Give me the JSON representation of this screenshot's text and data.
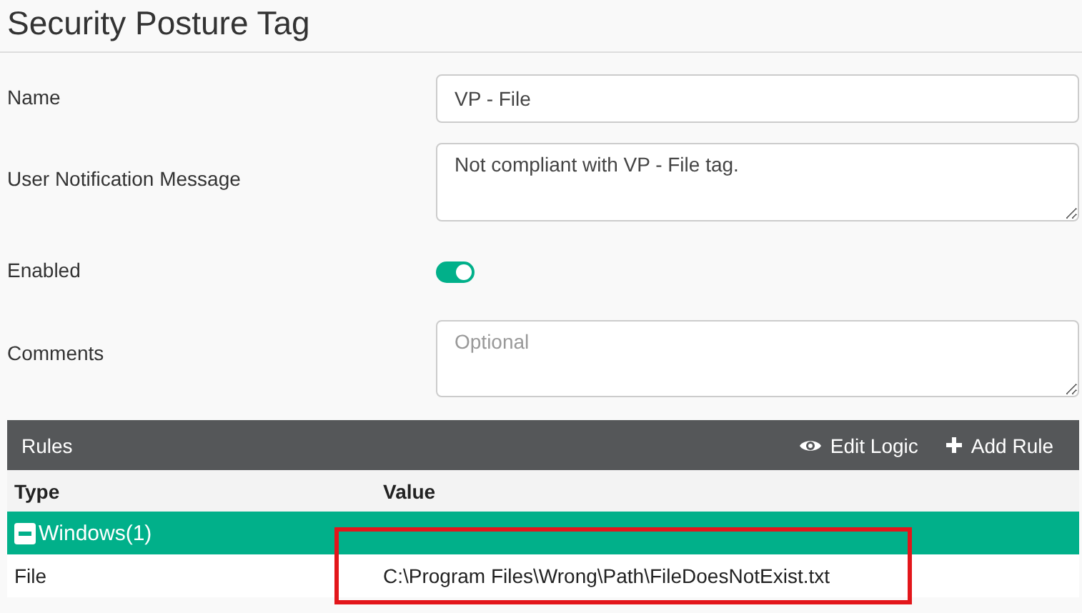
{
  "title": "Security Posture Tag",
  "fields": [
    {
      "kind": "text",
      "label": "Name",
      "value": "VP - File"
    },
    {
      "kind": "textarea",
      "label": "User Notification Message",
      "value": "Not compliant with VP - File tag."
    },
    {
      "kind": "toggle",
      "label": "Enabled",
      "on": true
    },
    {
      "kind": "textarea",
      "label": "Comments",
      "placeholder": "Optional"
    }
  ],
  "rules": {
    "title": "Rules",
    "actions": [
      {
        "kind": "eye",
        "label": "Edit Logic"
      },
      {
        "kind": "plus",
        "label": "Add Rule"
      }
    ],
    "columns": [
      "Type",
      "Value"
    ],
    "groups": [
      {
        "label": "Windows(1)",
        "expanded": true,
        "rows": [
          {
            "type": "File",
            "value": "C:\\Program Files\\Wrong\\Path\\FileDoesNotExist.txt",
            "highlighted": true
          }
        ]
      }
    ]
  }
}
